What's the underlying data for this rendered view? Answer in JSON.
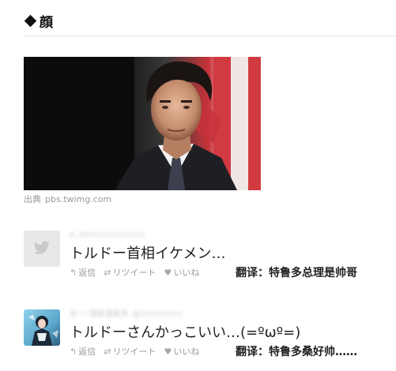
{
  "section": {
    "title": "顔"
  },
  "photo": {
    "caption_label": "出典",
    "caption_source": "pbs.twimg.com"
  },
  "tweets": [
    {
      "user_name": "A_8mnnnnnnnnnn",
      "avatar_icon": "twitter-bird-icon",
      "text": "トルドー首相イケメン…",
      "reply_label": "返信",
      "retweet_label": "リツイート",
      "like_label": "いいね",
      "translation": "翻译：特鲁多总理是帅哥"
    },
    {
      "user_name": "あー*温泉温泉多 @nnnnnnnn",
      "avatar_icon": "manga-character-avatar",
      "text": "トルドーさんかっこいい…(=ºωº=)",
      "reply_label": "返信",
      "retweet_label": "リツイート",
      "like_label": "いいね",
      "translation": "翻译：特鲁多桑好帅……"
    }
  ],
  "colors": {
    "text": "#222222",
    "muted": "#999999",
    "rule": "#e3e3e3"
  }
}
